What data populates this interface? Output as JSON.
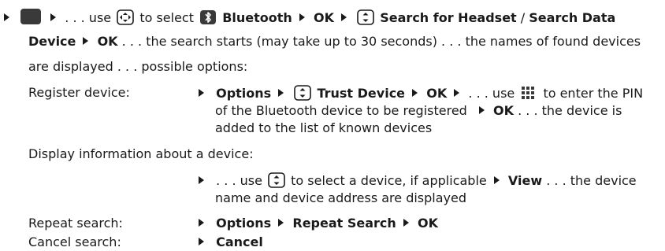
{
  "line1": {
    "ellipsis_use": ". . . use",
    "to_select": "to select",
    "bluetooth": "Bluetooth",
    "ok": "OK",
    "search_headset": "Search for Headset",
    "slash": "/",
    "search_data": "Search Data"
  },
  "line2": {
    "device": "Device",
    "ok": "OK",
    "text": ". . . the search starts (may take up to 30 seconds) . . . the names of found devices"
  },
  "line3": {
    "text": "are displayed  . . . possible options:"
  },
  "register": {
    "label": "Register device:",
    "options": "Options",
    "trust": "Trust Device",
    "ok": "OK",
    "use": ". . . use",
    "enter_pin": "to enter the PIN",
    "line2": "of the Bluetooth device to be registered",
    "ok2": "OK",
    "line2b": ". . . the device is",
    "line3": "added to the list of known devices"
  },
  "display_info": {
    "label": "Display information about a device:",
    "use": ". . . use",
    "select": "to select a device, if applicable",
    "view": "View",
    "after_view": ". . . the device",
    "line2": "name and device address are displayed"
  },
  "repeat": {
    "label": "Repeat search:",
    "options": "Options",
    "repeat": "Repeat Search",
    "ok": "OK"
  },
  "cancel": {
    "label": "Cancel search:",
    "cancel": "Cancel"
  },
  "colors": {
    "key_fill": "#3a3a3a",
    "text": "#1a1a1a"
  }
}
